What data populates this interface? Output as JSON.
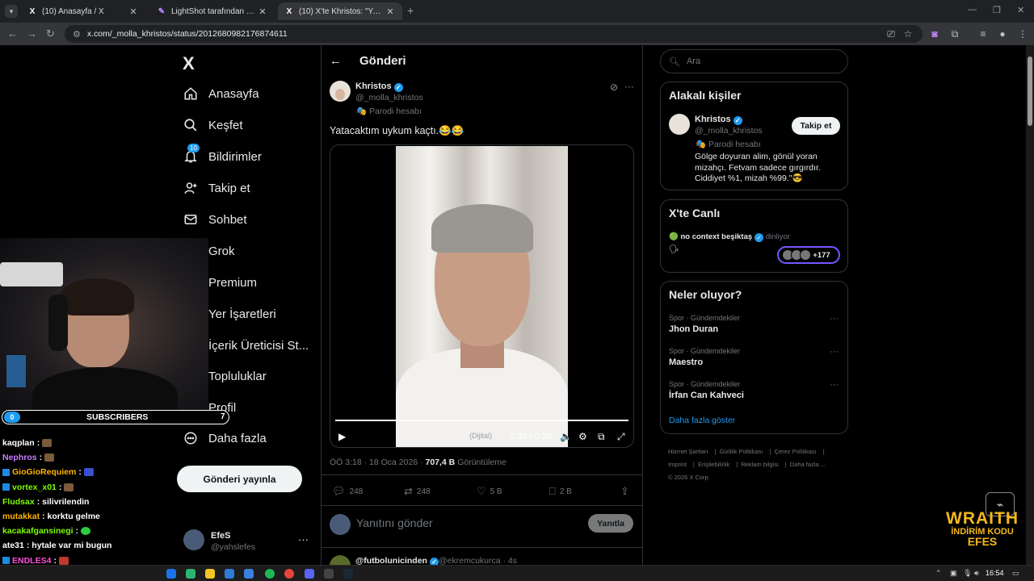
{
  "browser": {
    "tabs": [
      {
        "title": "(10) Anasayfa / X",
        "favicon": "X"
      },
      {
        "title": "LightShot tarafından Ekran Görü",
        "favicon": "✎"
      },
      {
        "title": "(10) X'te Khristos: \"Yatacaktım u",
        "favicon": "X"
      }
    ],
    "url": "x.com/_molla_khristos/status/2012680982176874611"
  },
  "sidebar": {
    "logo": "X",
    "notif_count": "10",
    "items": [
      {
        "label": "Anasayfa",
        "icon": "home-icon"
      },
      {
        "label": "Keşfet",
        "icon": "search-icon"
      },
      {
        "label": "Bildirimler",
        "icon": "bell-icon"
      },
      {
        "label": "Takip et",
        "icon": "follow-icon"
      },
      {
        "label": "Sohbet",
        "icon": "mail-icon"
      },
      {
        "label": "Grok",
        "icon": "grok-icon"
      },
      {
        "label": "Premium",
        "icon": "x-premium-icon"
      },
      {
        "label": "Yer İşaretleri",
        "icon": "bookmark-icon"
      },
      {
        "label": "İçerik Üreticisi St...",
        "icon": "creator-icon"
      },
      {
        "label": "Topluluklar",
        "icon": "communities-icon"
      },
      {
        "label": "Profil",
        "icon": "profile-icon"
      },
      {
        "label": "Daha fazla",
        "icon": "more-circle-icon"
      }
    ],
    "post_button": "Gönderi yayınla",
    "account": {
      "name": "EfeS",
      "handle": "@yahslefes"
    }
  },
  "overlay": {
    "subs_current": "0",
    "subs_label": "SUBSCRIBERS",
    "subs_goal": "7",
    "chat": [
      {
        "user": "kaqplan",
        "color": "#ffffff",
        "msg": ""
      },
      {
        "user": "Nephros",
        "color": "#c77dff",
        "msg": ""
      },
      {
        "user": "GioGioRequiem",
        "color": "#ffb300",
        "msg": ""
      },
      {
        "user": "vortex_x01",
        "color": "#7cfc00",
        "msg": ""
      },
      {
        "user": "Fludsax",
        "color": "#7cfc00",
        "msg": "silivrilendin"
      },
      {
        "user": "mutakkat",
        "color": "#ffb300",
        "msg": "korktu gelme"
      },
      {
        "user": "kacakafgansinegi",
        "color": "#7cfc00",
        "msg": ""
      },
      {
        "user": "ate31",
        "color": "#ffffff",
        "msg": "hytale var mi bugun"
      },
      {
        "user": "ENDLES4",
        "color": "#ff4fd8",
        "msg": ""
      }
    ],
    "promo_title": "WRAITH",
    "promo_line1": "İNDİRİM KODU",
    "promo_line2": "EFES"
  },
  "main": {
    "header_title": "Gönderi",
    "tweet": {
      "name": "Khristos",
      "handle": "@_molla_khristos",
      "parody": "Parodi hesabı",
      "text": "Yatacaktım uykum kaçtı.😂😂",
      "video_time": "0:30 / 0:30",
      "video_label": "(Dijital)",
      "time_date": "ÖÖ 3:18 · 18 Oca 2026 · ",
      "views": "707,4 B",
      "views_label": "Görüntüleme",
      "replies": "248",
      "reposts": "248",
      "likes": "5 B",
      "bookmarks": "2 B"
    },
    "reply_placeholder": "Yanıtını gönder",
    "reply_button": "Yanıtla",
    "next_tweet": {
      "name": "@futbolunicinden",
      "handle": "@ekremcukurca · 4s"
    }
  },
  "right": {
    "search_placeholder": "Ara",
    "related_title": "Alakalı kişiler",
    "related": {
      "name": "Khristos",
      "handle": "@_molla_khristos",
      "parody": "Parodi hesabı",
      "bio": "Gölge doyuran alim, gönül yoran mizahçı. Fetvam sadece gırgırdır. Ciddiyet %1, mizah %99.\"😎",
      "follow": "Takip et"
    },
    "live_title": "X'te Canlı",
    "live": {
      "name": "no context beşiktaş",
      "status": "dinliyor",
      "count": "+177"
    },
    "trends_title": "Neler oluyor?",
    "trends": [
      {
        "category": "Spor · Gündemdekiler",
        "name": "Jhon Duran"
      },
      {
        "category": "Spor · Gündemdekiler",
        "name": "Maestro"
      },
      {
        "category": "Spor · Gündemdekiler",
        "name": "İrfan Can Kahveci"
      }
    ],
    "show_more": "Daha fazla göster",
    "footer": [
      "Hizmet Şartları",
      "Gizlilik Politikası",
      "Çerez Politikası",
      "Imprint",
      "Erişilebilirlik",
      "Reklam bilgisi",
      "Daha fazla ...",
      "© 2026 X Corp."
    ]
  },
  "taskbar": {
    "time": "16:54"
  }
}
